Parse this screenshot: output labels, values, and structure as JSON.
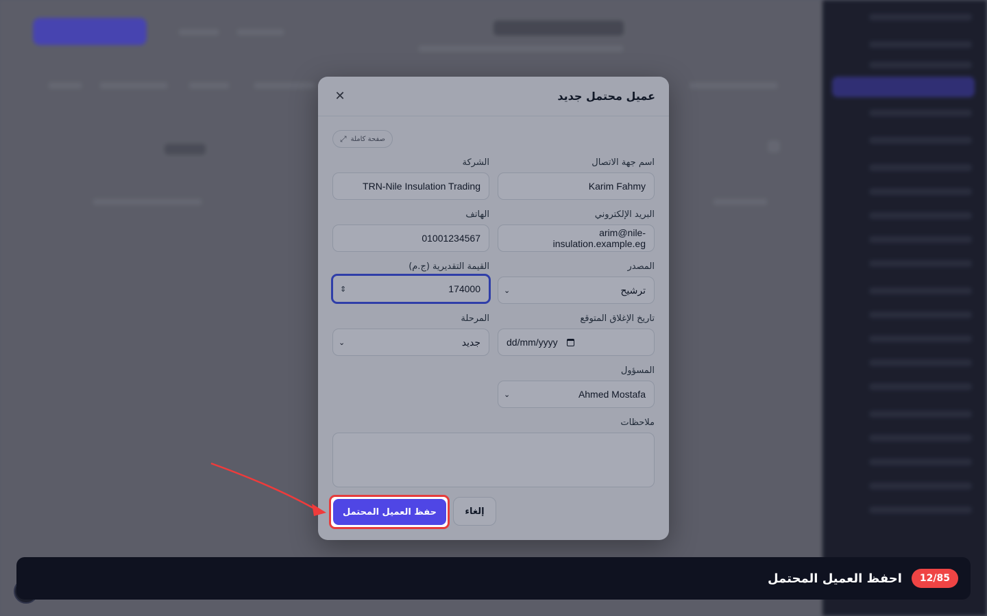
{
  "modal": {
    "title": "عميل محتمل جديد",
    "fullscreen_label": "صفحة كاملة",
    "fields": {
      "contact_name": {
        "label": "اسم جهة الاتصال",
        "value": "Karim Fahmy"
      },
      "company": {
        "label": "الشركة",
        "value": "TRN-Nile Insulation Trading"
      },
      "email": {
        "label": "البريد الإلكتروني",
        "value": "arim@nile-insulation.example.eg"
      },
      "phone": {
        "label": "الهاتف",
        "value": "01001234567"
      },
      "source": {
        "label": "المصدر",
        "value": "ترشيح"
      },
      "estimated_value": {
        "label": "القيمة التقديرية (ج.م)",
        "value": "174000"
      },
      "expected_close": {
        "label": "تاريخ الإغلاق المتوقع",
        "placeholder": "dd/mm/yyyy"
      },
      "stage": {
        "label": "المرحلة",
        "value": "جديد"
      },
      "owner": {
        "label": "المسؤول",
        "value": "Ahmed Mostafa"
      },
      "notes": {
        "label": "ملاحظات",
        "value": ""
      }
    },
    "cancel_label": "إلغاء",
    "save_label": "حفظ العميل المحتمل"
  },
  "tour": {
    "step": "12/85",
    "instruction": "احفظ العميل المحتمل"
  },
  "colors": {
    "primary": "#4f46e5",
    "highlight": "#e63b3b",
    "tour_bar": "#0f1220",
    "badge": "#ef4444"
  }
}
